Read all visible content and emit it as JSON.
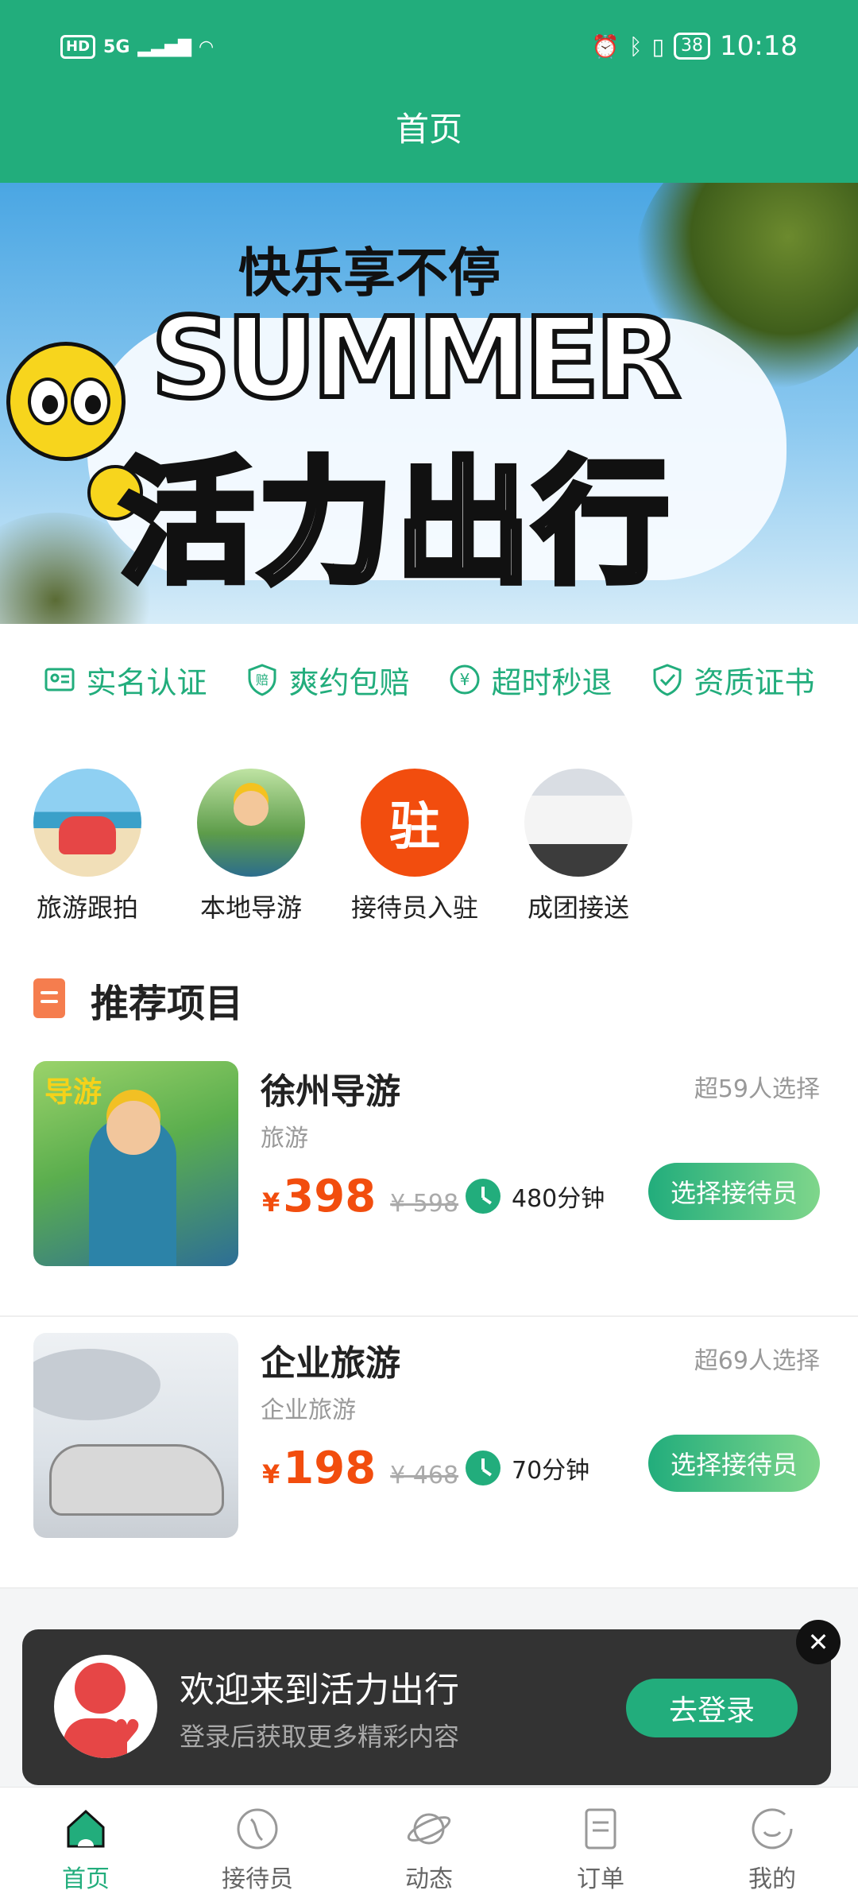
{
  "status_bar": {
    "network": "5G",
    "hd": "HD",
    "battery": "38",
    "time": "10:18"
  },
  "header": {
    "title": "首页"
  },
  "banner": {
    "slogan": "快乐享不停",
    "summer": "SUMMER",
    "main": "活力出行"
  },
  "guarantees": [
    {
      "label": "实名认证",
      "icon": "id-card-icon"
    },
    {
      "label": "爽约包赔",
      "icon": "shield-compensate-icon"
    },
    {
      "label": "超时秒退",
      "icon": "yen-refund-icon"
    },
    {
      "label": "资质证书",
      "icon": "shield-check-icon"
    }
  ],
  "categories": [
    {
      "label": "旅游跟拍"
    },
    {
      "label": "本地导游"
    },
    {
      "label": "接待员入驻",
      "badge": "驻"
    },
    {
      "label": "成团接送"
    }
  ],
  "section": {
    "title": "推荐项目"
  },
  "items": [
    {
      "title": "徐州导游",
      "subtitle": "旅游",
      "count": "超59人选择",
      "currency": "¥",
      "price": "398",
      "original_price": "¥ 598",
      "duration": "480分钟",
      "action": "选择接待员",
      "thumb_badge": "导游"
    },
    {
      "title": "企业旅游",
      "subtitle": "企业旅游",
      "count": "超69人选择",
      "currency": "¥",
      "price": "198",
      "original_price": "¥ 468",
      "duration": "70分钟",
      "action": "选择接待员"
    }
  ],
  "login_prompt": {
    "title": "欢迎来到活力出行",
    "subtitle": "登录后获取更多精彩内容",
    "button": "去登录"
  },
  "tabbar": [
    {
      "label": "首页",
      "active": true,
      "icon": "home-icon"
    },
    {
      "label": "接待员",
      "active": false,
      "icon": "receptionist-icon"
    },
    {
      "label": "动态",
      "active": false,
      "icon": "planet-icon"
    },
    {
      "label": "订单",
      "active": false,
      "icon": "order-icon"
    },
    {
      "label": "我的",
      "active": false,
      "icon": "profile-icon"
    }
  ],
  "colors": {
    "brand": "#22ad7c",
    "price": "#f24d0e"
  }
}
